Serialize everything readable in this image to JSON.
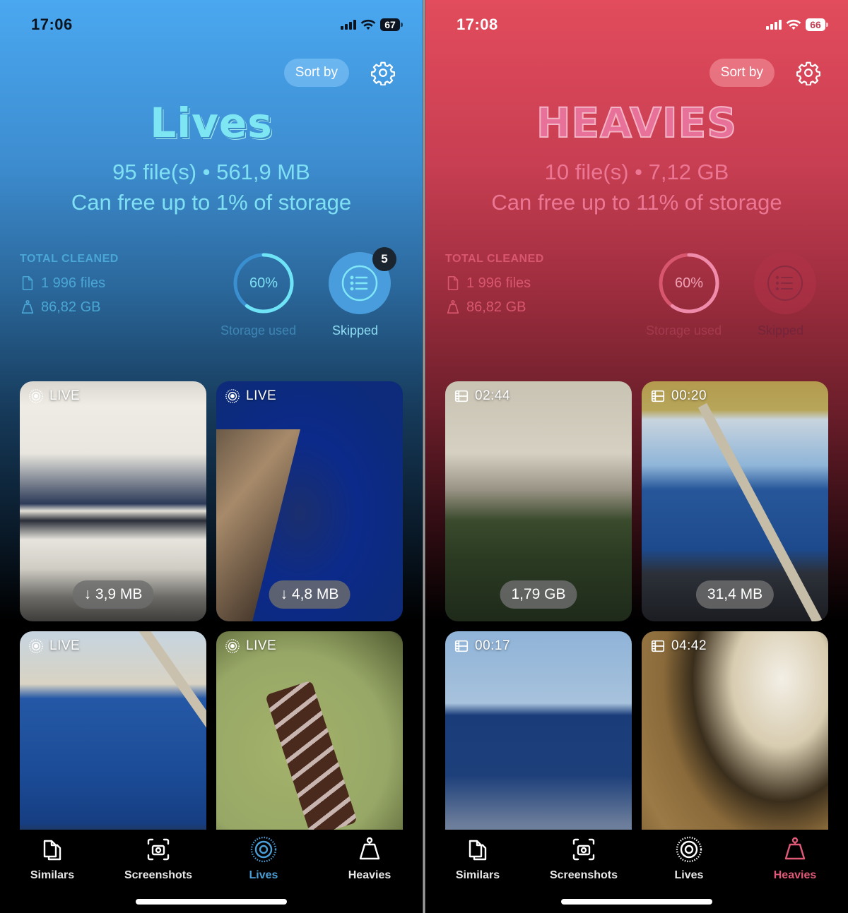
{
  "screens": [
    {
      "id": "lives",
      "status_bar": {
        "time": "17:06",
        "battery": "67"
      },
      "sort_label": "Sort by",
      "title": "Lives",
      "summary_line1": "95 file(s) • 561,9 MB",
      "summary_line2": "Can free up to 1% of storage",
      "totals": {
        "label": "TOTAL CLEANED",
        "files": "1 996 files",
        "size": "86,82 GB"
      },
      "storage": {
        "percent_label": "60%",
        "percent": 60,
        "caption": "Storage used"
      },
      "skipped": {
        "caption": "Skipped",
        "badge": "5"
      },
      "accent": "#4a9fd8",
      "tiles": [
        {
          "tag": "LIVE",
          "tag_icon": "live-photo-icon",
          "size": "↓ 3,9 MB",
          "scene": "boat"
        },
        {
          "tag": "LIVE",
          "tag_icon": "live-photo-icon",
          "size": "↓ 4,8 MB",
          "scene": "diver"
        },
        {
          "tag": "LIVE",
          "tag_icon": "live-photo-icon",
          "size": "",
          "scene": "boats"
        },
        {
          "tag": "LIVE",
          "tag_icon": "live-photo-icon",
          "size": "",
          "scene": "cake"
        }
      ],
      "tabs": [
        {
          "label": "Similars",
          "icon": "similars-icon"
        },
        {
          "label": "Screenshots",
          "icon": "screenshots-icon"
        },
        {
          "label": "Lives",
          "icon": "lives-icon",
          "active": true
        },
        {
          "label": "Heavies",
          "icon": "heavies-icon"
        }
      ]
    },
    {
      "id": "heavies",
      "status_bar": {
        "time": "17:08",
        "battery": "66"
      },
      "sort_label": "Sort by",
      "title": "HEAVIES",
      "summary_line1": "10 file(s) • 7,12 GB",
      "summary_line2": "Can free up to 11% of storage",
      "totals": {
        "label": "TOTAL CLEANED",
        "files": "1 996 files",
        "size": "86,82 GB"
      },
      "storage": {
        "percent_label": "60%",
        "percent": 60,
        "caption": "Storage used"
      },
      "skipped": {
        "caption": "Skipped",
        "badge": ""
      },
      "accent": "#e05a78",
      "tiles": [
        {
          "tag": "02:44",
          "tag_icon": "video-film-icon",
          "size": "1,79 GB",
          "scene": "building"
        },
        {
          "tag": "00:20",
          "tag_icon": "video-film-icon",
          "size": "31,4 MB",
          "scene": "sea-rail"
        },
        {
          "tag": "00:17",
          "tag_icon": "video-film-icon",
          "size": "",
          "scene": "wake"
        },
        {
          "tag": "04:42",
          "tag_icon": "video-film-icon",
          "size": "",
          "scene": "sand"
        }
      ],
      "tabs": [
        {
          "label": "Similars",
          "icon": "similars-icon"
        },
        {
          "label": "Screenshots",
          "icon": "screenshots-icon"
        },
        {
          "label": "Lives",
          "icon": "lives-icon"
        },
        {
          "label": "Heavies",
          "icon": "heavies-icon",
          "active": true
        }
      ]
    }
  ]
}
